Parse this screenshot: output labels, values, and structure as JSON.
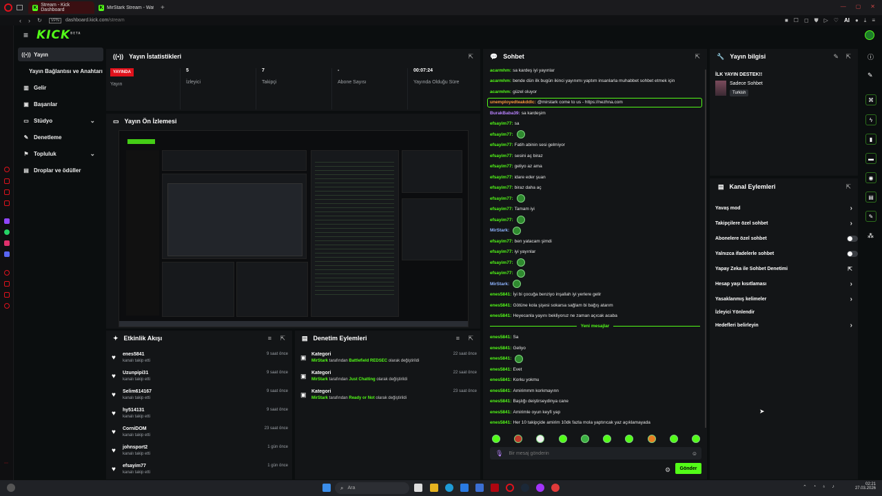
{
  "browser": {
    "tabs": [
      {
        "label": "Stream - Kick Dashboard"
      },
      {
        "label": "MirStark Stream - Watch L"
      }
    ],
    "vpn": "VPN",
    "url_domain": "dashboard.kick.com",
    "url_path": "/stream",
    "ai_label": "AI"
  },
  "app": {
    "logo": "KICK",
    "logo_sup": "BETA"
  },
  "nav": {
    "items": [
      {
        "label": "Yayın",
        "icon": "broadcast-icon"
      },
      {
        "label": "Yayın Bağlantısı ve Anahtarı",
        "icon": ""
      },
      {
        "label": "Gelir",
        "icon": "chart-icon"
      },
      {
        "label": "Başarılar",
        "icon": "trophy-icon"
      },
      {
        "label": "Stüdyo",
        "icon": "monitor-icon"
      },
      {
        "label": "Denetleme",
        "icon": "wrench-icon"
      },
      {
        "label": "Topluluk",
        "icon": "community-icon"
      },
      {
        "label": "Droplar ve ödüller",
        "icon": "gift-icon"
      }
    ]
  },
  "stats": {
    "title": "Yayın İstatistikleri",
    "live_badge": "YAYINDA",
    "live_label": "Yayın",
    "cols": [
      {
        "value": "5",
        "label": "İzleyici"
      },
      {
        "value": "7",
        "label": "Takipçi"
      },
      {
        "value": "-",
        "label": "Abone Sayısı"
      },
      {
        "value": "00:07:24",
        "label": "Yayında Olduğu Süre"
      }
    ]
  },
  "preview": {
    "title": "Yayın Ön İzlemesi"
  },
  "activity": {
    "title": "Etkinlik Akışı",
    "items": [
      {
        "name": "enes5841",
        "sub": "kanalı takip etti",
        "time": "9 saat önce"
      },
      {
        "name": "Uzunpipi31",
        "sub": "kanalı takip etti",
        "time": "9 saat önce"
      },
      {
        "name": "Selim614167",
        "sub": "kanalı takip etti",
        "time": "9 saat önce"
      },
      {
        "name": "hy514131",
        "sub": "kanalı takip etti",
        "time": "9 saat önce"
      },
      {
        "name": "CorniDOM",
        "sub": "kanalı takip etti",
        "time": "23 saat önce"
      },
      {
        "name": "johnsport2",
        "sub": "kanalı takip etti",
        "time": "1 gün önce"
      },
      {
        "name": "efsayim77",
        "sub": "kanalı takip etti",
        "time": "1 gün önce"
      }
    ]
  },
  "moderation": {
    "title": "Denetim Eylemleri",
    "items": [
      {
        "title": "Kategori",
        "user": "MirStark",
        "mid": " tarafından ",
        "value": "Battlefield REDSEC",
        "end": " olarak değiştirildi",
        "time": "22 saat önce"
      },
      {
        "title": "Kategori",
        "user": "MirStark",
        "mid": " tarafından ",
        "value": "Just Chatting",
        "end": " olarak değiştirildi",
        "time": "22 saat önce"
      },
      {
        "title": "Kategori",
        "user": "MirStark",
        "mid": " tarafından ",
        "value": "Ready or Not",
        "end": " olarak değiştirildi",
        "time": "23 saat önce"
      }
    ]
  },
  "chat": {
    "title": "Sohbet",
    "messages": [
      {
        "user": "acarmhm:",
        "text": "sa kardeş iyi yayınlar",
        "color": "#53fc18"
      },
      {
        "user": "acarmhm:",
        "text": "bende dün ilk bugün ikinci yayınımı yaptım insanlarla muhabbet sohbet etmek için",
        "color": "#53fc18"
      },
      {
        "user": "acarmhm:",
        "text": "güzel oluyor",
        "color": "#53fc18"
      },
      {
        "user": "unemployedteakddlc:",
        "text": "@mirstark come to us - https://nezhna.com",
        "color": "#ff9a3c",
        "highlight": true
      },
      {
        "user": "BurakBaba39:",
        "text": "sa kardeşim",
        "color": "#b983ff"
      },
      {
        "user": "efsayim77:",
        "text": "sa",
        "color": "#53fc18"
      },
      {
        "user": "efsayim77:",
        "text": "",
        "color": "#53fc18",
        "emote": true
      },
      {
        "user": "efsayim77:",
        "text": "Fatih abinin sesi gelmiyor",
        "color": "#53fc18"
      },
      {
        "user": "efsayim77:",
        "text": "sesini aç biraz",
        "color": "#53fc18"
      },
      {
        "user": "efsayim77:",
        "text": "geliyo az ama",
        "color": "#53fc18"
      },
      {
        "user": "efsayim77:",
        "text": "idare eder şuan",
        "color": "#53fc18"
      },
      {
        "user": "efsayim77:",
        "text": "biraz daha aç",
        "color": "#53fc18"
      },
      {
        "user": "efsayim77:",
        "text": "",
        "color": "#53fc18",
        "emote": true
      },
      {
        "user": "efsayim77:",
        "text": "Tamam iyi",
        "color": "#53fc18"
      },
      {
        "user": "efsayim77:",
        "text": "",
        "color": "#53fc18",
        "emote": true
      },
      {
        "user": "MirStark:",
        "text": "",
        "color": "#8fb4ff",
        "emote": true
      },
      {
        "user": "efsayim77:",
        "text": "ben yatacam şimdi",
        "color": "#53fc18"
      },
      {
        "user": "efsayim77:",
        "text": "iyi yayınlar",
        "color": "#53fc18"
      },
      {
        "user": "efsayim77:",
        "text": "",
        "color": "#53fc18",
        "emote": true
      },
      {
        "user": "efsayim77:",
        "text": "",
        "color": "#53fc18",
        "emote": true
      },
      {
        "user": "MirStark:",
        "text": "",
        "color": "#8fb4ff",
        "emote": true
      },
      {
        "user": "enes5841:",
        "text": "İyi bi çocuğa benziyo inşallah iyi yerlere gelir",
        "color": "#53fc18"
      },
      {
        "user": "enes5841:",
        "text": "Götüne kola şişesi sokarsa sağlam bi bağış atarım",
        "color": "#53fc18"
      },
      {
        "user": "enes5841:",
        "text": "Heyecanla yayını bekliyoruz ne zaman açıcak acaba",
        "color": "#53fc18"
      }
    ],
    "divider": "Yeni mesajlar",
    "new_messages": [
      {
        "user": "enes5841:",
        "text": "Sa",
        "color": "#53fc18"
      },
      {
        "user": "enes5841:",
        "text": "Geliyo",
        "color": "#53fc18"
      },
      {
        "user": "enes5841:",
        "text": "",
        "color": "#53fc18",
        "emote": true
      },
      {
        "user": "enes5841:",
        "text": "Evet",
        "color": "#53fc18"
      },
      {
        "user": "enes5841:",
        "text": "Korku yokmu",
        "color": "#53fc18"
      },
      {
        "user": "enes5841:",
        "text": "Amirimmm korkmayınn",
        "color": "#53fc18"
      },
      {
        "user": "enes5841:",
        "text": "Başlığı deiştirseydinya cane",
        "color": "#53fc18"
      },
      {
        "user": "enes5841:",
        "text": "Amirimle oyun keyfi yap",
        "color": "#53fc18"
      },
      {
        "user": "enes5841:",
        "text": "Her 10 takipçide amirim 10dk fazla mola yaptırıcak yaz açıklamayada",
        "color": "#53fc18"
      }
    ],
    "input_placeholder": "Bir mesaj gönderin",
    "send_label": "Gönder"
  },
  "info": {
    "title": "Yayın bilgisi",
    "stream_title": "İLK YAYIN DESTEK!!",
    "category": "Sadece Sohbet",
    "language": "Turkish"
  },
  "channel_actions": {
    "title": "Kanal Eylemleri",
    "items": [
      {
        "label": "Yavaş mod",
        "control": "arrow"
      },
      {
        "label": "Takipçilere özel sohbet",
        "control": "arrow"
      },
      {
        "label": "Abonelere özel sohbet",
        "control": "toggle"
      },
      {
        "label": "Yalnızca ifadelerle sohbet",
        "control": "toggle"
      },
      {
        "label": "Yapay Zeka ile Sohbet Denetimi",
        "control": "external"
      },
      {
        "label": "Hesap yaşı kısıtlaması",
        "control": "arrow"
      },
      {
        "label": "Yasaklanmış kelimeler",
        "control": "arrow"
      },
      {
        "label": "İzleyici Yönlendir",
        "control": "none"
      },
      {
        "label": "Hedefleri belirleyin",
        "control": "arrow"
      }
    ]
  },
  "taskbar": {
    "search": "Ara",
    "time": "02:21",
    "date": "27.03.2026"
  },
  "colors": {
    "accent": "#53fc18",
    "live": "#e1121c",
    "panel_bg": "#131517",
    "page_bg": "#0b0e0f"
  }
}
